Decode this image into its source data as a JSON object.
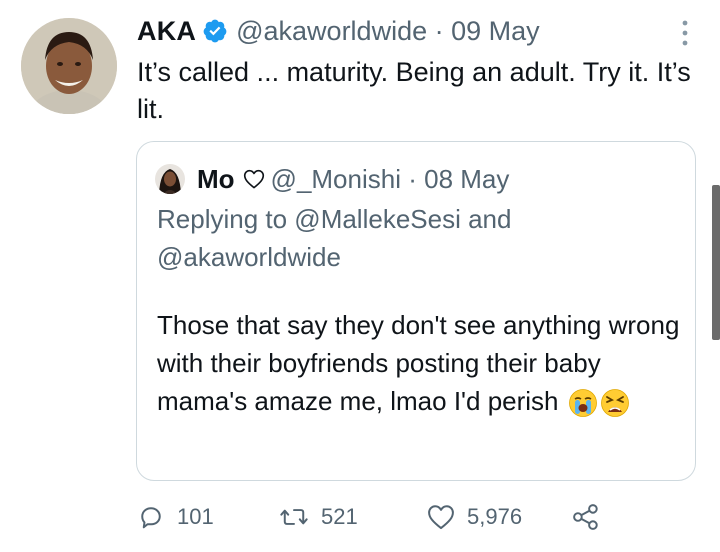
{
  "tweet": {
    "author_name": "AKA",
    "author_handle": "@akaworldwide",
    "date": "09 May",
    "text": "It’s called ... maturity. Being an adult. Try it. It’s lit."
  },
  "quoted": {
    "author_name": "Mo",
    "author_handle": "@_Monishi",
    "date": "08 May",
    "replying_to": "Replying to @MallekeSesi and @akaworldwide",
    "text": "Those that say they don't see anything wrong with their boyfriends posting their baby mama's amaze me, lmao I'd perish",
    "emojis": [
      "loudly-crying-face",
      "tired-face"
    ]
  },
  "actions": {
    "replies": "101",
    "retweets": "521",
    "likes": "5,976"
  },
  "colors": {
    "verified_blue": "#1d9bf0",
    "secondary_text": "#536471",
    "border": "#cfd9de"
  }
}
